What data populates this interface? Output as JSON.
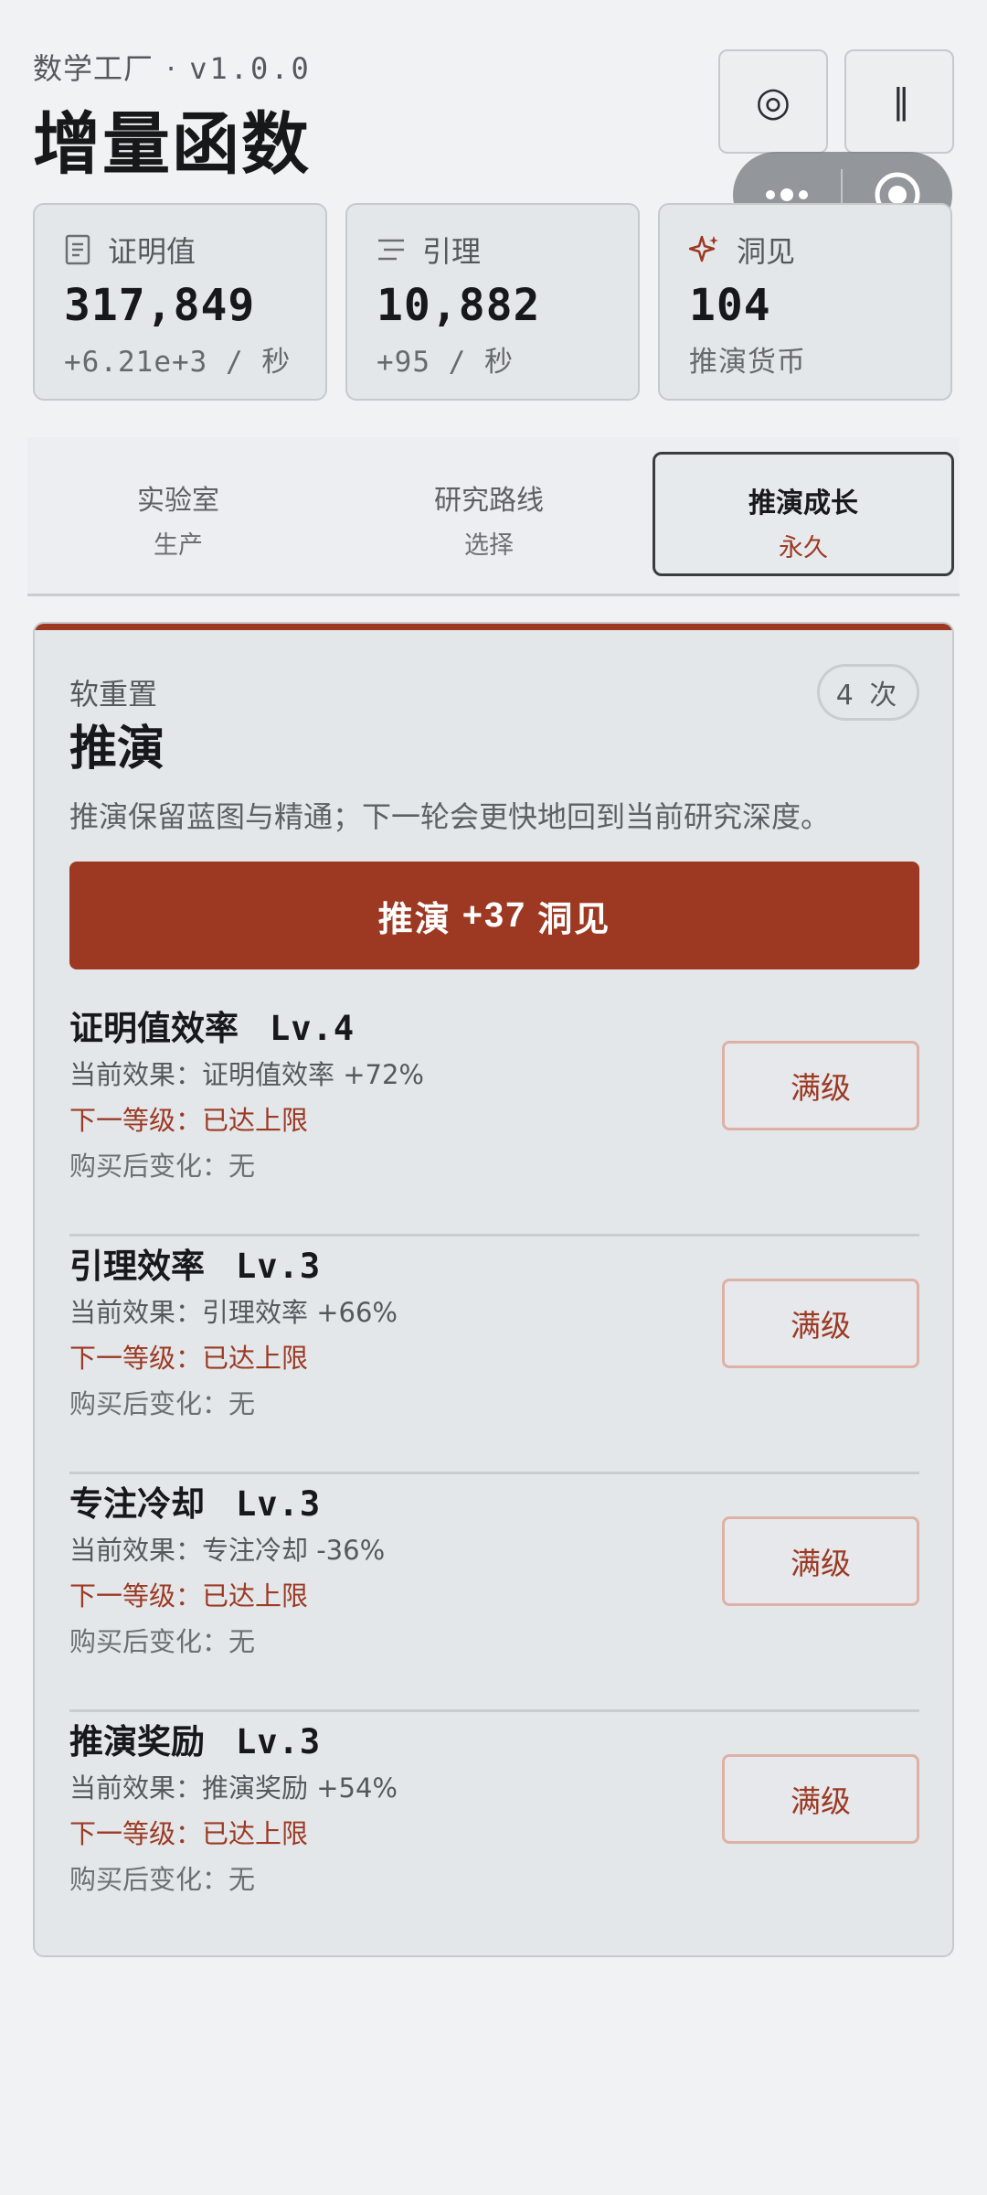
{
  "header": {
    "app_name": "数学工厂",
    "separator": "·",
    "version": "v1.0.0",
    "title": "增量函数"
  },
  "top_buttons": {
    "target_glyph": "◎",
    "pause_glyph": "||"
  },
  "stats": [
    {
      "label": "证明值",
      "value": "317,849",
      "rate": "+6.21e+3 / 秒",
      "icon": "document-icon"
    },
    {
      "label": "引理",
      "value": "10,882",
      "rate": "+95 / 秒",
      "icon": "filter-lines-icon"
    },
    {
      "label": "洞见",
      "value": "104",
      "rate": "推演货币",
      "icon": "sparkle-icon"
    }
  ],
  "tabs": [
    {
      "label": "实验室",
      "sub": "生产",
      "active": false
    },
    {
      "label": "研究路线",
      "sub": "选择",
      "active": false
    },
    {
      "label": "推演成长",
      "sub": "永久",
      "active": true
    }
  ],
  "panel": {
    "subtitle": "软重置",
    "title": "推演",
    "count": "4 次",
    "description": "推演保留蓝图与精通；下一轮会更快地回到当前研究深度。",
    "action": {
      "verb": "推演",
      "amount": "+37",
      "unit": "洞见"
    }
  },
  "upgrades": [
    {
      "name": "证明值效率",
      "level": "Lv.4",
      "current": "当前效果：证明值效率 +72%",
      "next": "下一等级：已达上限",
      "after": "购买后变化：无",
      "button": "满级"
    },
    {
      "name": "引理效率",
      "level": "Lv.3",
      "current": "当前效果：引理效率 +66%",
      "next": "下一等级：已达上限",
      "after": "购买后变化：无",
      "button": "满级"
    },
    {
      "name": "专注冷却",
      "level": "Lv.3",
      "current": "当前效果：专注冷却 -36%",
      "next": "下一等级：已达上限",
      "after": "购买后变化：无",
      "button": "满级"
    },
    {
      "name": "推演奖励",
      "level": "Lv.3",
      "current": "当前效果：推演奖励 +54%",
      "next": "下一等级：已达上限",
      "after": "购买后变化：无",
      "button": "满级"
    }
  ],
  "colors": {
    "accent": "#9d3822",
    "background": "#f0f2f4",
    "card": "#e4e7ea"
  }
}
